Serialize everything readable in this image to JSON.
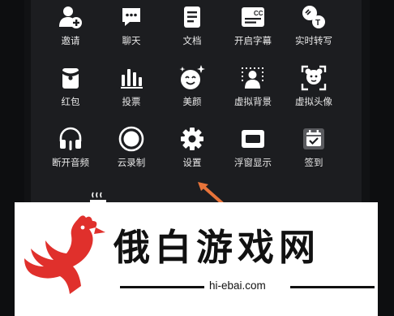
{
  "menu": {
    "items": [
      {
        "label": "邀请",
        "icon": "add-person-icon"
      },
      {
        "label": "聊天",
        "icon": "chat-bubble-icon"
      },
      {
        "label": "文档",
        "icon": "document-icon"
      },
      {
        "label": "开启字幕",
        "icon": "closed-caption-icon"
      },
      {
        "label": "实时转写",
        "icon": "speech-to-text-icon"
      },
      {
        "label": "红包",
        "icon": "red-packet-icon"
      },
      {
        "label": "投票",
        "icon": "bar-chart-icon"
      },
      {
        "label": "美颜",
        "icon": "beauty-face-icon"
      },
      {
        "label": "虚拟背景",
        "icon": "virtual-background-icon"
      },
      {
        "label": "虚拟头像",
        "icon": "virtual-avatar-icon"
      },
      {
        "label": "断开音频",
        "icon": "headphones-icon"
      },
      {
        "label": "云录制",
        "icon": "record-icon"
      },
      {
        "label": "设置",
        "icon": "gear-icon"
      },
      {
        "label": "浮窗显示",
        "icon": "floating-window-icon"
      },
      {
        "label": "签到",
        "icon": "check-in-calendar-icon"
      }
    ]
  },
  "watermark": {
    "brand_name": "俄白游戏网",
    "site": "hi-ebai.com",
    "logo": "rooster-logo"
  },
  "colors": {
    "panel": "#1c1d20",
    "icon": "#ffffff",
    "arrow": "#e8743a",
    "logo_red": "#e0302c"
  }
}
